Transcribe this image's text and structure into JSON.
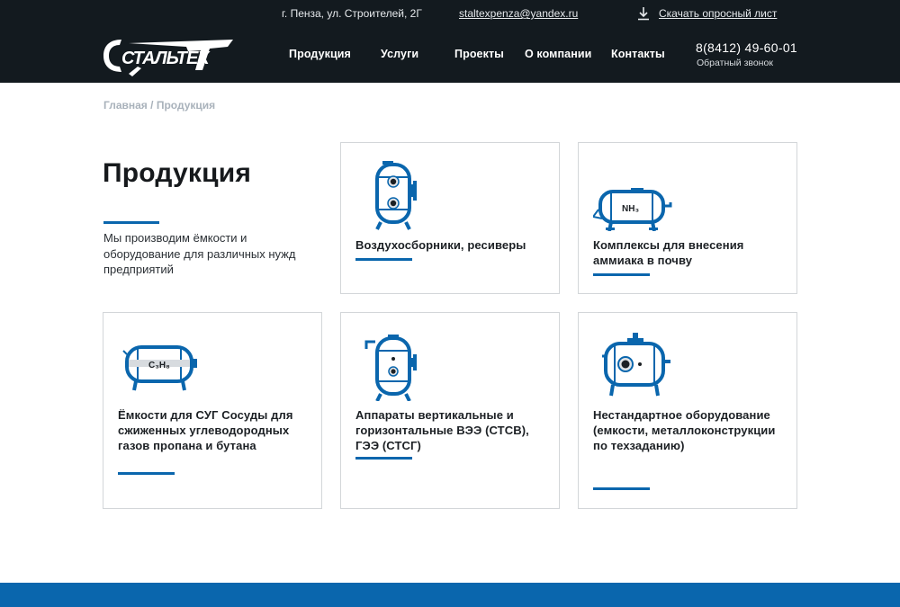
{
  "header": {
    "address": "г. Пенза, ул. Строителей, 2Г",
    "email": "staltexpenza@yandex.ru",
    "download_label": "Скачать опросный лист",
    "download_icon": "download-icon",
    "logo_text": "СТАЛЬТЕХ",
    "nav": [
      {
        "label": "Продукция"
      },
      {
        "label": "Услуги"
      },
      {
        "label": "Проекты"
      },
      {
        "label": "О компании"
      },
      {
        "label": "Контакты"
      }
    ],
    "phone": "8(8412) 49-60-01",
    "callback": "Обратный звонок"
  },
  "breadcrumb": {
    "home": "Главная",
    "separator": " / ",
    "current": "Продукция"
  },
  "intro": {
    "title": "Продукция",
    "description": "Мы производим ёмкости и оборудование для различных нужд предприятий"
  },
  "products": [
    {
      "label": "Воздухосборники, ресиверы",
      "icon": "vertical-tank-icon"
    },
    {
      "label": "Комплексы для внесения аммиака в почву",
      "icon": "ammonia-tank-icon",
      "formula": "NH₃"
    },
    {
      "label": "Ёмкости для СУГ Сосуды для сжиженных углеводородных газов пропана и бутана",
      "icon": "lpg-tank-icon",
      "formula": "C₃H₈"
    },
    {
      "label": "Аппараты вертикальные и горизонтальные ВЭЭ (СТСВ), ГЭЭ (СТСГ)",
      "icon": "vertical-apparatus-icon"
    },
    {
      "label": "Нестандартное оборудование (емкости, металлоконструкции по техзаданию)",
      "icon": "custom-tank-icon"
    }
  ],
  "colors": {
    "accent": "#0a66ad",
    "header_bg": "#131a1f",
    "card_border": "#d3d6d9"
  }
}
